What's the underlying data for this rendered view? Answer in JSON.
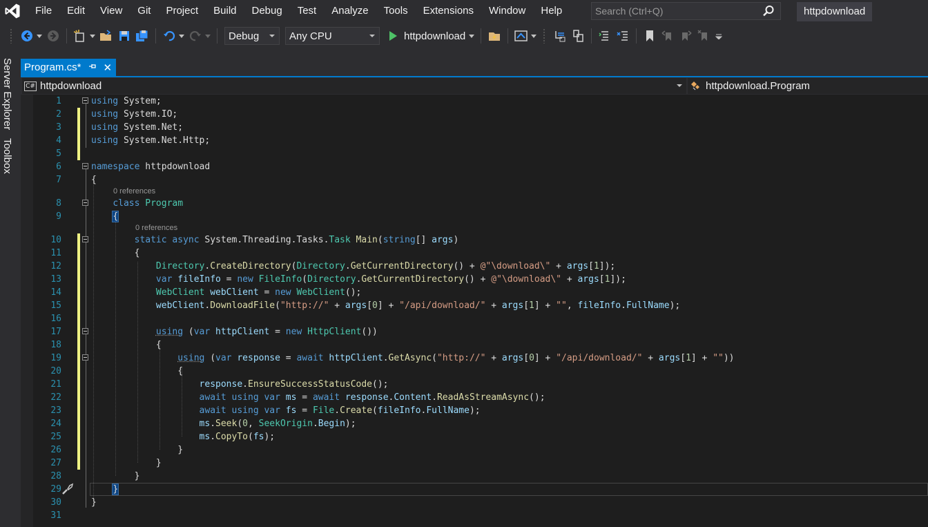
{
  "menu": {
    "items": [
      "File",
      "Edit",
      "View",
      "Git",
      "Project",
      "Build",
      "Debug",
      "Test",
      "Analyze",
      "Tools",
      "Extensions",
      "Window",
      "Help"
    ],
    "search_placeholder": "Search (Ctrl+Q)",
    "solution_name": "httpdownload"
  },
  "toolbar": {
    "configuration": "Debug",
    "platform": "Any CPU",
    "run_label": "httpdownload"
  },
  "left_rail": {
    "server_explorer": "Server Explorer",
    "toolbox": "Toolbox"
  },
  "document_tab": {
    "title": "Program.cs*",
    "pin_icon": "pin-icon",
    "close_glyph": "✕"
  },
  "navigation_bar": {
    "project_badge": "C#",
    "project": "httpdownload",
    "type": "httpdownload.Program"
  },
  "editor": {
    "codelens_text": "0 references",
    "changed_lines": [
      2,
      3,
      4,
      5,
      10,
      11,
      12,
      13,
      14,
      15,
      16,
      17,
      18,
      19,
      20,
      21,
      22,
      23,
      24,
      25,
      26,
      27
    ],
    "lines": [
      {
        "n": 1,
        "code": "using System;"
      },
      {
        "n": 2,
        "code": "using System.IO;"
      },
      {
        "n": 3,
        "code": "using System.Net;"
      },
      {
        "n": 4,
        "code": "using System.Net.Http;"
      },
      {
        "n": 5,
        "code": ""
      },
      {
        "n": 6,
        "code": "namespace httpdownload"
      },
      {
        "n": 7,
        "code": "{"
      },
      {
        "n": 8,
        "code": "    class Program"
      },
      {
        "n": 9,
        "code": "    {"
      },
      {
        "n": 10,
        "code": "        static async System.Threading.Tasks.Task Main(string[] args)"
      },
      {
        "n": 11,
        "code": "        {"
      },
      {
        "n": 12,
        "code": "            Directory.CreateDirectory(Directory.GetCurrentDirectory() + @\"\\download\\\" + args[1]);"
      },
      {
        "n": 13,
        "code": "            var fileInfo = new FileInfo(Directory.GetCurrentDirectory() + @\"\\download\\\" + args[1]);"
      },
      {
        "n": 14,
        "code": "            WebClient webClient = new WebClient();"
      },
      {
        "n": 15,
        "code": "            webClient.DownloadFile(\"http://\" + args[0] + \"/api/download/\" + args[1] + \"\", fileInfo.FullName);"
      },
      {
        "n": 16,
        "code": ""
      },
      {
        "n": 17,
        "code": "            using (var httpClient = new HttpClient())"
      },
      {
        "n": 18,
        "code": "            {"
      },
      {
        "n": 19,
        "code": "                using (var response = await httpClient.GetAsync(\"http://\" + args[0] + \"/api/download/\" + args[1] + \"\"))"
      },
      {
        "n": 20,
        "code": "                {"
      },
      {
        "n": 21,
        "code": "                    response.EnsureSuccessStatusCode();"
      },
      {
        "n": 22,
        "code": "                    await using var ms = await response.Content.ReadAsStreamAsync();"
      },
      {
        "n": 23,
        "code": "                    await using var fs = File.Create(fileInfo.FullName);"
      },
      {
        "n": 24,
        "code": "                    ms.Seek(0, SeekOrigin.Begin);"
      },
      {
        "n": 25,
        "code": "                    ms.CopyTo(fs);"
      },
      {
        "n": 26,
        "code": "                }"
      },
      {
        "n": 27,
        "code": "            }"
      },
      {
        "n": 28,
        "code": "        }"
      },
      {
        "n": 29,
        "code": "    }"
      },
      {
        "n": 30,
        "code": "}"
      },
      {
        "n": 31,
        "code": ""
      }
    ]
  },
  "colors": {
    "accent": "#007acc",
    "keyword": "#569cd6",
    "type": "#4ec9b0",
    "method": "#dcdcaa",
    "string": "#d69d85",
    "number": "#b5cea8",
    "identifier": "#9cdcfe",
    "line_number": "#2b91af",
    "change_marker": "#eff284"
  }
}
